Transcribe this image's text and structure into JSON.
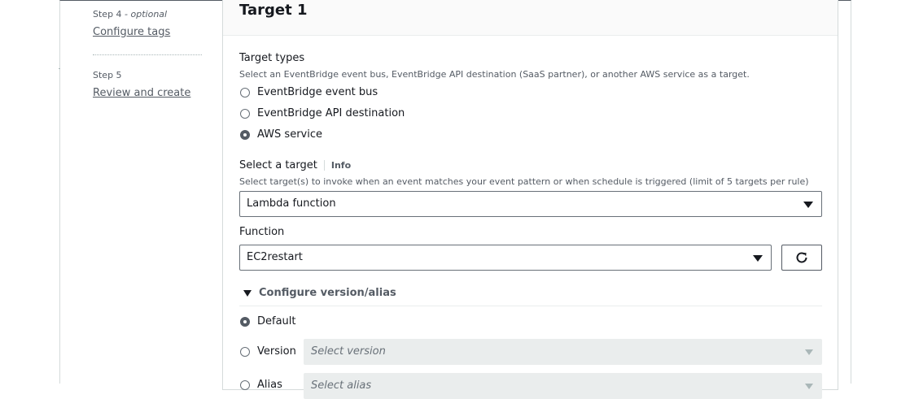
{
  "steps": [
    {
      "step_prefix": "Step 4",
      "step_suffix": " - optional",
      "title": "Configure tags"
    },
    {
      "step_prefix": "Step 5",
      "step_suffix": "",
      "title": "Review and create"
    }
  ],
  "panel": {
    "title": "Target 1",
    "target_types": {
      "label": "Target types",
      "description": "Select an EventBridge event bus, EventBridge API destination (SaaS partner), or another AWS service as a target.",
      "options": [
        "EventBridge event bus",
        "EventBridge API destination",
        "AWS service"
      ],
      "selected": "AWS service"
    },
    "select_target": {
      "label": "Select a target",
      "info": "Info",
      "description": "Select target(s) to invoke when an event matches your event pattern or when schedule is triggered (limit of 5 targets per rule)",
      "value": "Lambda function"
    },
    "function": {
      "label": "Function",
      "value": "EC2restart"
    },
    "version_alias": {
      "toggle_label": "Configure version/alias",
      "options": [
        "Default",
        "Version",
        "Alias"
      ],
      "selected": "Default",
      "version_placeholder": "Select version",
      "alias_placeholder": "Select alias"
    }
  }
}
